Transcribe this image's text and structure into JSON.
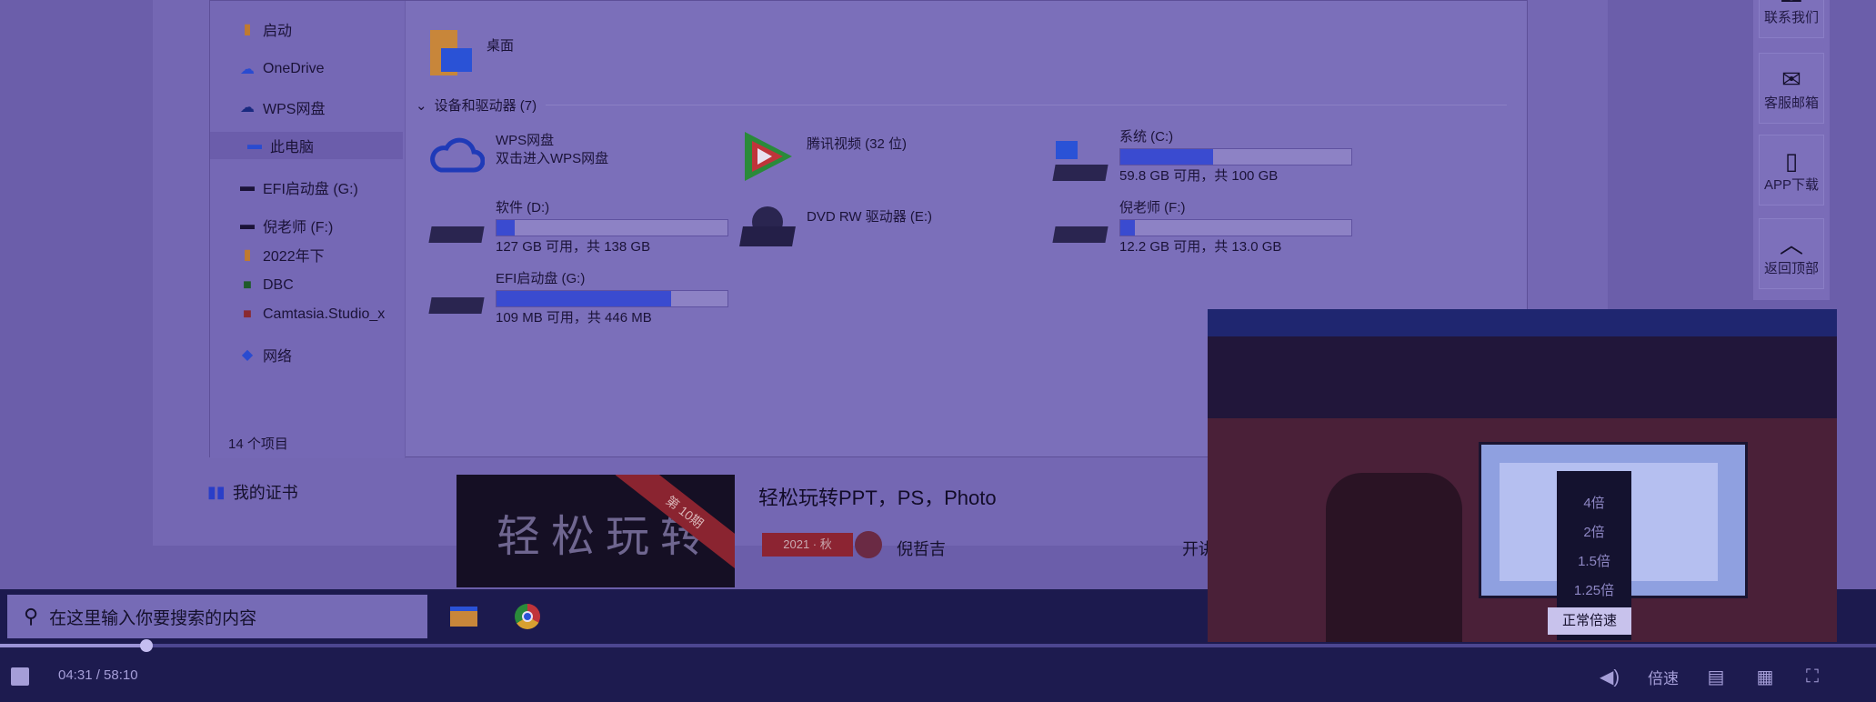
{
  "site": {
    "float_buttons": [
      {
        "icon": "headset-icon",
        "label": "联系我们"
      },
      {
        "icon": "mail-icon",
        "label": "客服邮箱"
      },
      {
        "icon": "phone-icon",
        "label": "APP下载"
      },
      {
        "icon": "up-arrow-icon",
        "label": "返回顶部"
      }
    ],
    "cert_label": "我的证书",
    "course": {
      "title": "轻松玩转PPT，PS，Photo",
      "thumb_text": "轻松玩转",
      "ribbon": "第 10期",
      "tag": "2021 · 秋",
      "author": "倪哲吉",
      "open": "开讲"
    }
  },
  "explorer": {
    "nav_items": [
      "启动",
      "OneDrive",
      "WPS网盘",
      "此电脑",
      "EFI启动盘 (G:)",
      "倪老师 (F:)",
      "2022年下",
      "DBC",
      "Camtasia.Studio_x",
      "网络"
    ],
    "selected_index": 3,
    "status": "14 个项目",
    "desktop_label": "桌面",
    "group_header": "设备和驱动器 (7)",
    "drives": [
      {
        "name": "WPS网盘",
        "sub": "双击进入WPS网盘",
        "icon": "cloud-icon"
      },
      {
        "name": "腾讯视频 (32 位)",
        "sub": "",
        "icon": "tencent-video-icon"
      },
      {
        "name": "系统 (C:)",
        "sub": "59.8 GB 可用，共 100 GB",
        "icon": "windows-drive-icon",
        "used": 0.402
      },
      {
        "name": "软件 (D:)",
        "sub": "127 GB 可用，共 138 GB",
        "icon": "drive-icon",
        "used": 0.08
      },
      {
        "name": "DVD RW 驱动器 (E:)",
        "sub": "",
        "icon": "dvd-drive-icon"
      },
      {
        "name": "倪老师 (F:)",
        "sub": "12.2 GB 可用，共 13.0 GB",
        "icon": "drive-icon",
        "used": 0.062
      },
      {
        "name": "EFI启动盘 (G:)",
        "sub": "109 MB 可用，共 446 MB",
        "icon": "drive-icon",
        "used": 0.756
      }
    ]
  },
  "taskbar": {
    "search_placeholder": "在这里输入你要搜索的内容",
    "apps": [
      "file-explorer-icon",
      "chrome-icon"
    ]
  },
  "player": {
    "time": "04:31 / 58:10",
    "progress": 0.078,
    "speed_label": "倍速",
    "speed_options": [
      "4倍",
      "2倍",
      "1.5倍",
      "1.25倍",
      "正常倍速"
    ],
    "speed_selected": "正常倍速"
  }
}
